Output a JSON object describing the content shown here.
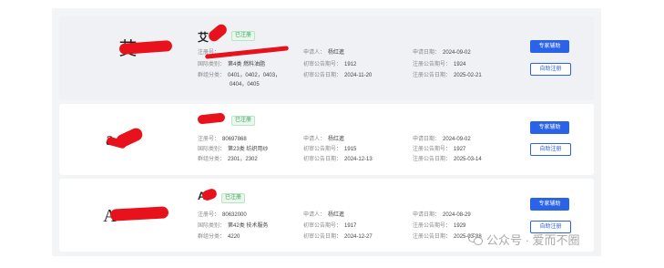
{
  "cards": [
    {
      "logo_text": "艾",
      "name": "艾",
      "status": "已注册",
      "reg_no_label": "注册号：",
      "reg_no": "",
      "class_label": "国际类别：",
      "class": "第4类 燃料油脂",
      "group_label": "群组分类：",
      "groups_line1": "0401，0402，0403，",
      "groups_line2": "0404，0405",
      "applicant_label": "申请人：",
      "applicant": "杨红進",
      "prelim_no_label": "初审公告期号：",
      "prelim_no": "1912",
      "prelim_date_label": "初审公告日期：",
      "prelim_date": "2024-11-20",
      "apply_date_label": "申请日期：",
      "apply_date": "2024-09-02",
      "reg_pub_no_label": "注册公告期号：",
      "reg_pub_no": "1924",
      "reg_pub_date_label": "注册公告日期：",
      "reg_pub_date": "2025-02-21",
      "btn_primary": "专家辅助",
      "btn_secondary": "自助注册"
    },
    {
      "logo_text": "a",
      "name": "",
      "status": "已注册",
      "reg_no_label": "注册号：",
      "reg_no": "80697868",
      "class_label": "国际类别：",
      "class": "第23类 纺织用纱",
      "group_label": "群组分类：",
      "groups_line1": "2301，2302",
      "groups_line2": "",
      "applicant_label": "申请人：",
      "applicant": "杨红進",
      "prelim_no_label": "初审公告期号：",
      "prelim_no": "1915",
      "prelim_date_label": "初审公告日期：",
      "prelim_date": "2024-12-13",
      "apply_date_label": "申请日期：",
      "apply_date": "2024-09-02",
      "reg_pub_no_label": "注册公告期号：",
      "reg_pub_no": "1927",
      "reg_pub_date_label": "注册公告日期：",
      "reg_pub_date": "2025-03-14",
      "btn_primary": "专家辅助",
      "btn_secondary": "自助注册"
    },
    {
      "logo_text": "A",
      "name": "A",
      "status": "已注册",
      "reg_no_label": "注册号：",
      "reg_no": "80632000",
      "class_label": "国际类别：",
      "class": "第42类 技术服务",
      "group_label": "群组分类：",
      "groups_line1": "4220",
      "groups_line2": "",
      "applicant_label": "申请人：",
      "applicant": "杨红進",
      "prelim_no_label": "初审公告期号：",
      "prelim_no": "1917",
      "prelim_date_label": "初审公告日期：",
      "prelim_date": "2024-12-27",
      "apply_date_label": "申请日期：",
      "apply_date": "2024-08-29",
      "reg_pub_no_label": "注册公告期号：",
      "reg_pub_no": "1929",
      "reg_pub_date_label": "注册公告日期：",
      "reg_pub_date": "2025-03-28",
      "btn_primary": "专家辅助",
      "btn_secondary": "自助注册"
    }
  ],
  "watermark": "公众号 · 爱而不圈",
  "colors": {
    "primary": "#2b63e8",
    "status_green": "#3aa55a",
    "redaction": "#e8121c"
  }
}
